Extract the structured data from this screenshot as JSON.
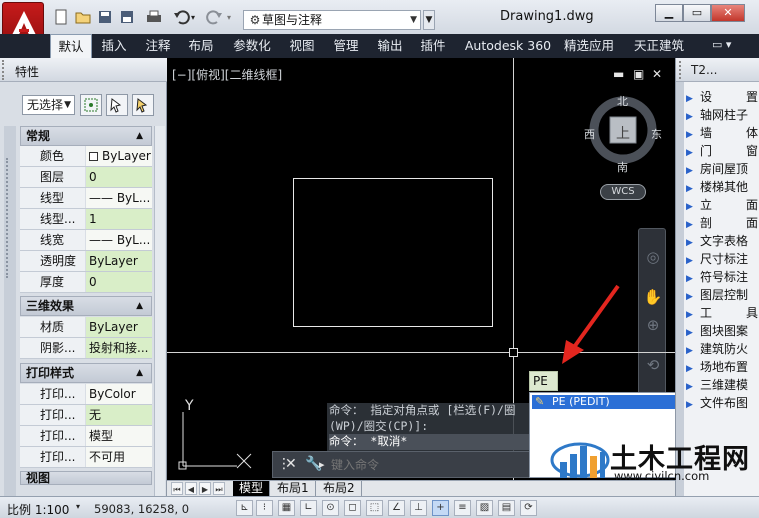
{
  "titlebar": {
    "workspace": "草图与注释",
    "document_title": "Drawing1.dwg",
    "quick_access_icons": [
      "new-file-icon",
      "open-folder-icon",
      "save-icon",
      "save-as-icon",
      "print-icon",
      "undo-icon",
      "redo-icon"
    ],
    "window_controls": [
      "minimize-icon",
      "restore-icon",
      "close-icon"
    ]
  },
  "ribbon": {
    "tabs": [
      "默认",
      "插入",
      "注释",
      "布局",
      "参数化",
      "视图",
      "管理",
      "输出",
      "插件",
      "Autodesk 360",
      "精选应用",
      "天正建筑"
    ],
    "active_tab": "默认"
  },
  "properties": {
    "title": "特性",
    "selection": "无选择",
    "sections": {
      "general": {
        "title": "常规",
        "rows": [
          {
            "key": "颜色",
            "value": "ByLayer"
          },
          {
            "key": "图层",
            "value": "0"
          },
          {
            "key": "线型",
            "value": "—— ByL..."
          },
          {
            "key": "线型...",
            "value": "1"
          },
          {
            "key": "线宽",
            "value": "—— ByL..."
          },
          {
            "key": "透明度",
            "value": "ByLayer"
          },
          {
            "key": "厚度",
            "value": "0"
          }
        ]
      },
      "3d": {
        "title": "三维效果",
        "rows": [
          {
            "key": "材质",
            "value": "ByLayer"
          },
          {
            "key": "阴影...",
            "value": "投射和接..."
          }
        ]
      },
      "plot": {
        "title": "打印样式",
        "rows": [
          {
            "key": "打印...",
            "value": "ByColor"
          },
          {
            "key": "打印...",
            "value": "无"
          },
          {
            "key": "打印...",
            "value": "模型"
          },
          {
            "key": "打印...",
            "value": "不可用"
          }
        ]
      },
      "view": {
        "title": "视图"
      }
    }
  },
  "viewport": {
    "label": "[−][俯视][二维线框]",
    "controls": [
      "minimize",
      "maximize",
      "close"
    ],
    "compass": {
      "north": "北",
      "south": "南",
      "east": "东",
      "west": "西",
      "top": "上"
    },
    "wcs": "WCS",
    "ucs_y": "Y"
  },
  "command": {
    "history": [
      "命令： 指定对角点或 [栏选(F)/圈",
      "(WP)/圈交(CP)]:",
      "命令： *取消*"
    ],
    "placeholder": "键入命令",
    "typed": "PE",
    "suggestion": "PE (PEDIT)"
  },
  "tool_palette": {
    "title": "T2...",
    "items": [
      "设　　置",
      "轴网柱子",
      "墙　　体",
      "门　　窗",
      "房间屋顶",
      "楼梯其他",
      "立　　面",
      "剖　　面",
      "文字表格",
      "尺寸标注",
      "符号标注",
      "图层控制",
      "工　　具",
      "图块图案",
      "建筑防火",
      "场地布置",
      "三维建模",
      "文件布图"
    ]
  },
  "layout_tabs": [
    "模型",
    "布局1",
    "布局2"
  ],
  "status": {
    "scale": "比例 1:100",
    "coordinates": "59083, 16258, 0"
  },
  "watermark": {
    "text": "土木工程网",
    "url": "www.civilcn.com"
  },
  "colors": {
    "canvas": "#000000",
    "ribbon": "#1e2430",
    "value_cell": "#d9eec8",
    "highlight": "#2b6fd6",
    "annotation_arrow": "#e3261f"
  }
}
